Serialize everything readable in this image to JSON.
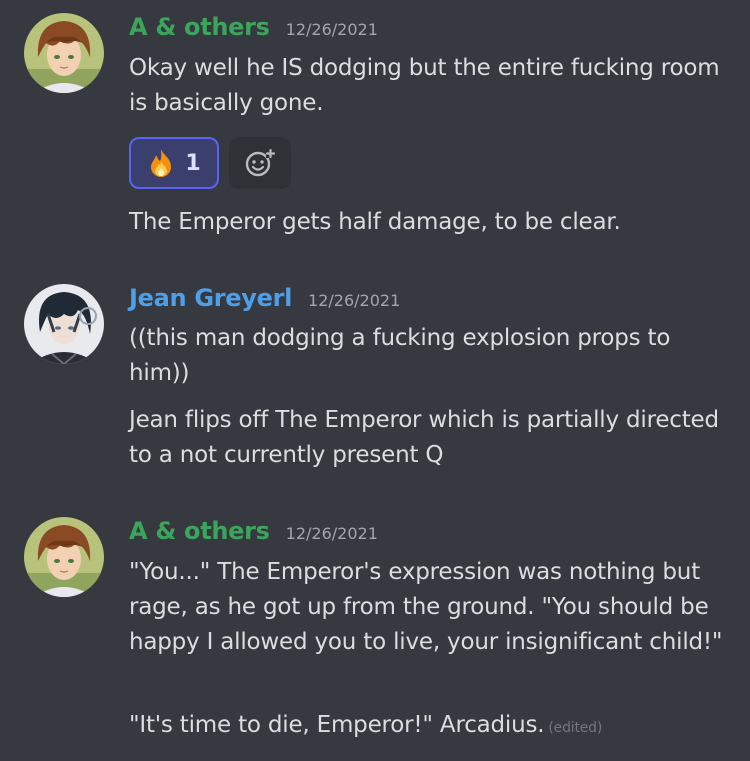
{
  "colors": {
    "background": "#36393f",
    "username_green": "#3ba55c",
    "username_blue": "#4f9ee8",
    "text": "#dcddde",
    "timestamp": "#a3a6aa",
    "reaction_border": "#5865f2"
  },
  "messages": [
    {
      "author": "A & others",
      "timestamp": "12/26/2021",
      "lines": [
        "Okay well he IS dodging but the entire fucking room is basically gone.",
        "The Emperor gets half damage, to be clear."
      ],
      "reaction": {
        "emoji_icon": "fire-icon",
        "count": "1"
      }
    },
    {
      "author": "Jean Greyerl",
      "timestamp": "12/26/2021",
      "lines": [
        "((this man dodging a fucking explosion props to him))",
        "Jean flips off The Emperor which is partially directed to a not currently present Q"
      ]
    },
    {
      "author": "A & others",
      "timestamp": "12/26/2021",
      "lines": [
        "\"You...\" The Emperor's expression was nothing but rage, as he got up from the ground. \"You should be happy I allowed you to live, your insignificant child!\"",
        "\"It's time to die, Emperor!\" Arcadius."
      ],
      "edited_label": "(edited)"
    }
  ]
}
